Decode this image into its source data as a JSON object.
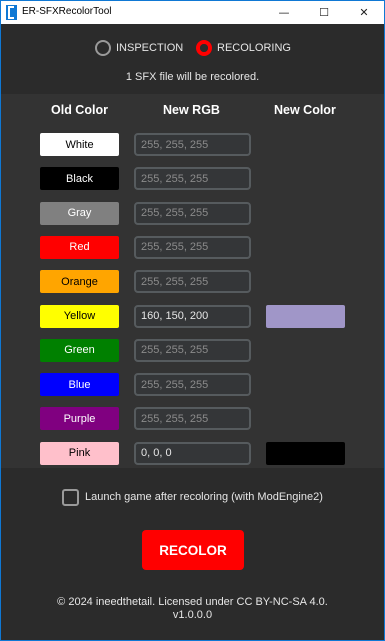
{
  "window": {
    "title": "ER-SFXRecolorTool",
    "minimize_glyph": "—",
    "maximize_glyph": "☐",
    "close_glyph": "✕"
  },
  "mode": {
    "options": [
      "INSPECTION",
      "RECOLORING"
    ],
    "selected": "RECOLORING",
    "accent": "#ff0000"
  },
  "info_text": "1 SFX file will be recolored.",
  "table": {
    "headers": [
      "Old Color",
      "New RGB",
      "New Color"
    ],
    "rows": [
      {
        "label": "White",
        "bg": "#ffffff",
        "fg": "#000000",
        "rgb": "",
        "placeholder": "255, 255, 255",
        "new_color": null
      },
      {
        "label": "Black",
        "bg": "#000000",
        "fg": "#ffffff",
        "rgb": "",
        "placeholder": "255, 255, 255",
        "new_color": null
      },
      {
        "label": "Gray",
        "bg": "#808080",
        "fg": "#ffffff",
        "rgb": "",
        "placeholder": "255, 255, 255",
        "new_color": null
      },
      {
        "label": "Red",
        "bg": "#ff0000",
        "fg": "#ffffff",
        "rgb": "",
        "placeholder": "255, 255, 255",
        "new_color": null
      },
      {
        "label": "Orange",
        "bg": "#ffa500",
        "fg": "#000000",
        "rgb": "",
        "placeholder": "255, 255, 255",
        "new_color": null
      },
      {
        "label": "Yellow",
        "bg": "#ffff00",
        "fg": "#000000",
        "rgb": "160, 150, 200",
        "placeholder": "255, 255, 255",
        "new_color": "#a096c8"
      },
      {
        "label": "Green",
        "bg": "#008000",
        "fg": "#ffffff",
        "rgb": "",
        "placeholder": "255, 255, 255",
        "new_color": null
      },
      {
        "label": "Blue",
        "bg": "#0000ff",
        "fg": "#ffffff",
        "rgb": "",
        "placeholder": "255, 255, 255",
        "new_color": null
      },
      {
        "label": "Purple",
        "bg": "#800080",
        "fg": "#ffffff",
        "rgb": "",
        "placeholder": "255, 255, 255",
        "new_color": null
      },
      {
        "label": "Pink",
        "bg": "#ffc0cb",
        "fg": "#000000",
        "rgb": "0, 0, 0",
        "placeholder": "255, 255, 255",
        "new_color": "#000000"
      }
    ]
  },
  "launch_checkbox": {
    "label": "Launch game after recoloring (with ModEngine2)",
    "checked": false
  },
  "recolor_button": "RECOLOR",
  "footer": {
    "license": "© 2024 ineedthetail. Licensed under CC BY-NC-SA 4.0.",
    "version": "v1.0.0.0"
  }
}
